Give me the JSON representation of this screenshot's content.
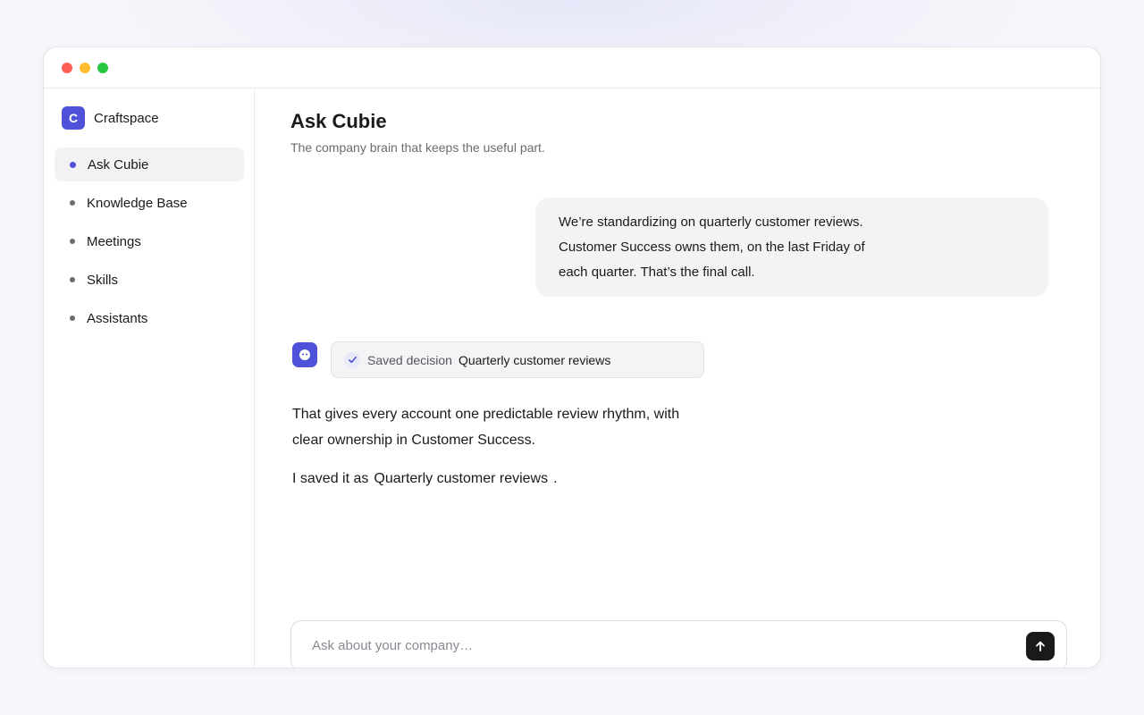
{
  "window": {
    "controls": [
      "close",
      "minimize",
      "maximize"
    ]
  },
  "sidebar": {
    "brand": {
      "logo_letter": "C",
      "name": "Craftspace",
      "color": "#4f52d9"
    },
    "items": [
      {
        "label": "Ask Cubie",
        "active": true
      },
      {
        "label": "Knowledge Base",
        "active": false
      },
      {
        "label": "Meetings",
        "active": false
      },
      {
        "label": "Skills",
        "active": false
      },
      {
        "label": "Assistants",
        "active": false
      }
    ]
  },
  "main": {
    "title": "Ask Cubie",
    "subtitle": "The company brain that keeps the useful part."
  },
  "conversation": {
    "user_message": "We’re standardizing on quarterly customer reviews. Customer Success owns them, on the last Friday of each quarter. That’s the final call.",
    "assistant": {
      "avatar_icon": "bot-face-icon",
      "decision_chip": {
        "label": "Saved decision",
        "value": "Quarterly customer reviews",
        "icon": "check-icon"
      },
      "reply_line_1": "That gives every account one predictable review rhythm, with clear ownership in Customer Success.",
      "reply_line_2_prefix": "I saved it as",
      "reply_line_2_ref": "Quarterly customer reviews",
      "reply_line_2_suffix": "."
    }
  },
  "composer": {
    "placeholder": "Ask about your company…",
    "value": "",
    "send_icon": "arrow-up-icon"
  },
  "colors": {
    "accent": "#4f52d9",
    "send_button": "#1a1a1a"
  }
}
